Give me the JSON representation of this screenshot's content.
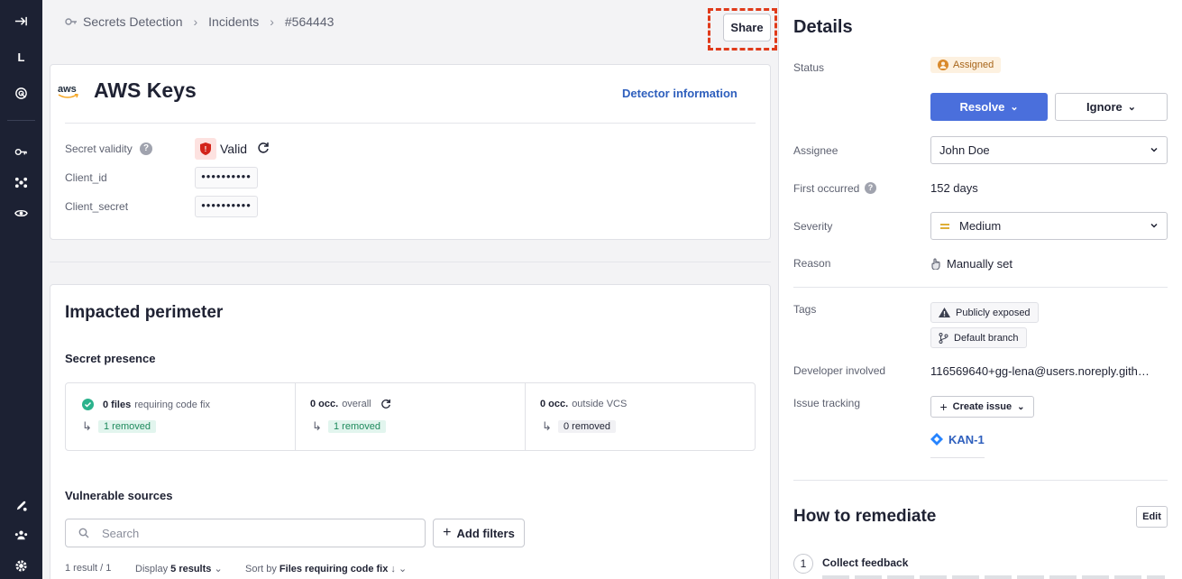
{
  "nav": {
    "avatar_letter": "L"
  },
  "breadcrumb": {
    "item1": "Secrets Detection",
    "item2": "Incidents",
    "item3": "#564443"
  },
  "share_label": "Share",
  "incident": {
    "vendor": "aws",
    "title": "AWS Keys",
    "detector_link": "Detector information",
    "validity_label": "Secret validity",
    "validity_value": "Valid",
    "fields": [
      {
        "label": "Client_id",
        "value": "••••••••••"
      },
      {
        "label": "Client_secret",
        "value": "••••••••••"
      }
    ]
  },
  "perimeter": {
    "title": "Impacted perimeter",
    "presence_title": "Secret presence",
    "cells": [
      {
        "bold": "0 files",
        "text": "requiring code fix",
        "badge": "1 removed"
      },
      {
        "bold": "0 occ.",
        "text": "overall",
        "badge": "1 removed"
      },
      {
        "bold": "0 occ.",
        "text": "outside VCS",
        "badge": "0 removed"
      }
    ],
    "sources_title": "Vulnerable sources",
    "search_placeholder": "Search",
    "add_filters": "Add filters",
    "result_count": "1 result",
    "page_info": "/ 1",
    "display_label": "Display",
    "display_value": "5 results",
    "sort_label": "Sort by",
    "sort_value": "Files requiring code fix"
  },
  "details": {
    "title": "Details",
    "status_label": "Status",
    "status_value": "Assigned",
    "resolve": "Resolve",
    "ignore": "Ignore",
    "assignee_label": "Assignee",
    "assignee_value": "John Doe",
    "first_label": "First occurred",
    "first_value": "152 days",
    "severity_label": "Severity",
    "severity_value": "Medium",
    "reason_label": "Reason",
    "reason_value": "Manually set",
    "tags_label": "Tags",
    "tag1": "Publicly exposed",
    "tag2": "Default branch",
    "dev_label": "Developer involved",
    "dev_value": "116569640+gg-lena@users.noreply.gith…",
    "issue_label": "Issue tracking",
    "create_issue": "Create issue",
    "issue_link": "KAN-1"
  },
  "remediate": {
    "title": "How to remediate",
    "edit": "Edit",
    "step_num": "1",
    "step_title": "Collect feedback"
  },
  "colors": {
    "primary": "#4a6fdc",
    "nav_bg": "#1c2133",
    "accent_red": "#e03a1a"
  }
}
